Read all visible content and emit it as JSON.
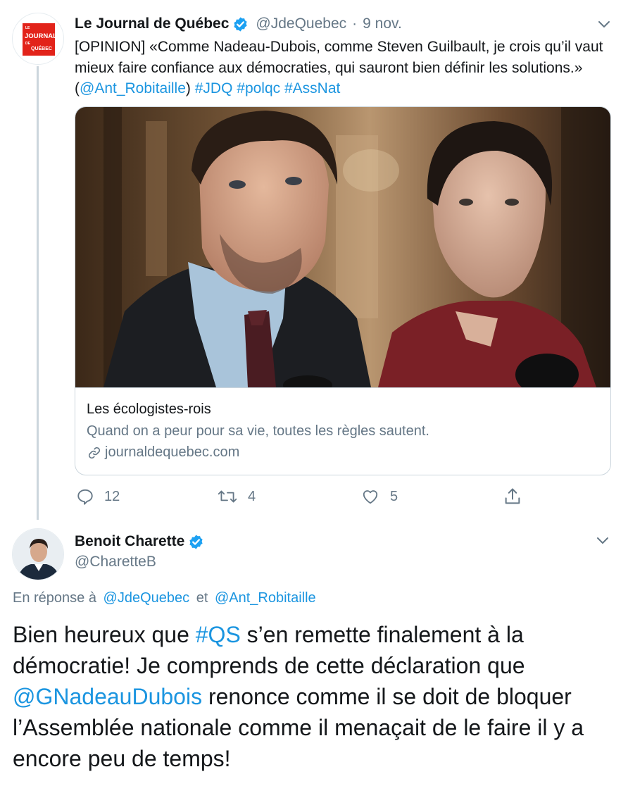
{
  "tweet1": {
    "name": "Le Journal de Québec",
    "handle": "@JdeQuebec",
    "separator": "·",
    "time": "9 nov.",
    "logo_lines": [
      "LE",
      "JOURNAL",
      "DE",
      "QUÉBEC"
    ],
    "text_prefix": "[OPINION] «Comme Nadeau-Dubois, comme Steven Guilbault, je crois qu’il vaut mieux faire confiance aux démocraties, qui sauront bien définir les solutions.» (",
    "mention": "@Ant_Robitaille",
    "text_after_mention": ") ",
    "hashtags": [
      "#JDQ",
      "#polqc",
      "#AssNat"
    ],
    "card": {
      "title": "Les écologistes-rois",
      "description": "Quand on a peur pour sa vie, toutes les règles sautent.",
      "domain": "journaldequebec.com"
    },
    "actions": {
      "replies": "12",
      "retweets": "4",
      "likes": "5"
    }
  },
  "tweet2": {
    "name": "Benoit Charette",
    "handle": "@CharetteB",
    "reply_prefix": "En réponse à",
    "reply_to_1": "@JdeQuebec",
    "reply_and": "et",
    "reply_to_2": "@Ant_Robitaille",
    "text_part1": "Bien heureux que ",
    "hashtag": "#QS",
    "text_part2": " s’en remette finalement à la démocratie!  Je comprends de cette déclaration que ",
    "mention": "@GNadeauDubois",
    "text_part3": " renonce comme il se doit de bloquer l’Assemblée nationale comme il menaçait de le faire il y a encore peu de temps!"
  },
  "colors": {
    "link": "#1b95e0",
    "secondary_text": "#657786",
    "verified": "#1da1f2",
    "logo_red": "#e2231a",
    "border": "#ccd6dd"
  },
  "icons": [
    "verified-badge-icon",
    "chevron-down-icon",
    "link-icon",
    "reply-icon",
    "retweet-icon",
    "like-icon",
    "share-icon"
  ]
}
